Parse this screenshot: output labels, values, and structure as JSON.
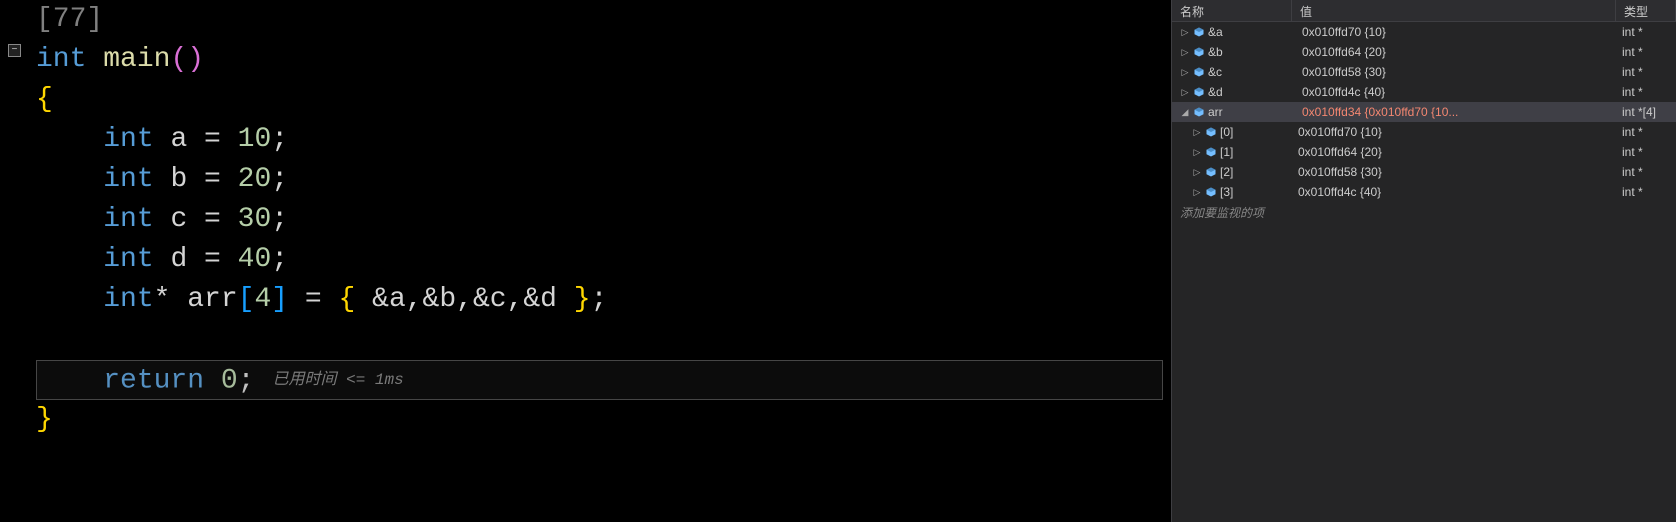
{
  "editor": {
    "fold_symbol": "−",
    "top_line": "[77]",
    "lines": [
      {
        "tokens": [
          {
            "t": "kw",
            "v": "int"
          },
          {
            "t": "sp",
            "v": " "
          },
          {
            "t": "ident",
            "v": "main"
          },
          {
            "t": "paren",
            "v": "()"
          }
        ]
      },
      {
        "tokens": [
          {
            "t": "brace",
            "v": "{"
          }
        ]
      },
      {
        "tokens": [
          {
            "t": "indent",
            "v": "    "
          },
          {
            "t": "kw",
            "v": "int"
          },
          {
            "t": "sp",
            "v": " "
          },
          {
            "t": "op",
            "v": "a = "
          },
          {
            "t": "num",
            "v": "10"
          },
          {
            "t": "punct",
            "v": ";"
          }
        ]
      },
      {
        "tokens": [
          {
            "t": "indent",
            "v": "    "
          },
          {
            "t": "kw",
            "v": "int"
          },
          {
            "t": "sp",
            "v": " "
          },
          {
            "t": "op",
            "v": "b = "
          },
          {
            "t": "num",
            "v": "20"
          },
          {
            "t": "punct",
            "v": ";"
          }
        ]
      },
      {
        "tokens": [
          {
            "t": "indent",
            "v": "    "
          },
          {
            "t": "kw",
            "v": "int"
          },
          {
            "t": "sp",
            "v": " "
          },
          {
            "t": "op",
            "v": "c = "
          },
          {
            "t": "num",
            "v": "30"
          },
          {
            "t": "punct",
            "v": ";"
          }
        ]
      },
      {
        "tokens": [
          {
            "t": "indent",
            "v": "    "
          },
          {
            "t": "kw",
            "v": "int"
          },
          {
            "t": "sp",
            "v": " "
          },
          {
            "t": "op",
            "v": "d = "
          },
          {
            "t": "num",
            "v": "40"
          },
          {
            "t": "punct",
            "v": ";"
          }
        ]
      },
      {
        "tokens": [
          {
            "t": "indent",
            "v": "    "
          },
          {
            "t": "kw",
            "v": "int"
          },
          {
            "t": "op",
            "v": "* "
          },
          {
            "t": "op",
            "v": "arr"
          },
          {
            "t": "bracket",
            "v": "["
          },
          {
            "t": "num",
            "v": "4"
          },
          {
            "t": "bracket",
            "v": "]"
          },
          {
            "t": "op",
            "v": " = "
          },
          {
            "t": "brace",
            "v": "{ "
          },
          {
            "t": "op",
            "v": "&a,&b,&c,&d "
          },
          {
            "t": "brace",
            "v": "}"
          },
          {
            "t": "punct",
            "v": ";"
          }
        ]
      },
      {
        "tokens": []
      },
      {
        "tokens": [
          {
            "t": "indent",
            "v": "    "
          },
          {
            "t": "kw",
            "v": "return"
          },
          {
            "t": "sp",
            "v": " "
          },
          {
            "t": "num",
            "v": "0"
          },
          {
            "t": "punct",
            "v": ";"
          }
        ],
        "timing": true
      },
      {
        "tokens": [
          {
            "t": "brace",
            "v": "}"
          }
        ]
      }
    ],
    "timing_label": "已用时间 <= 1ms"
  },
  "watch": {
    "headers": {
      "name": "名称",
      "value": "值",
      "type": "类型"
    },
    "rows": [
      {
        "depth": 1,
        "expand": "▶",
        "name": "&a",
        "value": "0x010ffd70 {10}",
        "type": "int *"
      },
      {
        "depth": 1,
        "expand": "▶",
        "name": "&b",
        "value": "0x010ffd64 {20}",
        "type": "int *"
      },
      {
        "depth": 1,
        "expand": "▶",
        "name": "&c",
        "value": "0x010ffd58 {30}",
        "type": "int *"
      },
      {
        "depth": 1,
        "expand": "▶",
        "name": "&d",
        "value": "0x010ffd4c {40}",
        "type": "int *"
      },
      {
        "depth": 1,
        "expand": "▲",
        "name": "arr",
        "value": "0x010ffd34 {0x010ffd70 {10...",
        "type": "int *[4]",
        "selected": true,
        "changed": true
      },
      {
        "depth": 2,
        "expand": "▶",
        "name": "[0]",
        "value": "0x010ffd70 {10}",
        "type": "int *"
      },
      {
        "depth": 2,
        "expand": "▶",
        "name": "[1]",
        "value": "0x010ffd64 {20}",
        "type": "int *"
      },
      {
        "depth": 2,
        "expand": "▶",
        "name": "[2]",
        "value": "0x010ffd58 {30}",
        "type": "int *"
      },
      {
        "depth": 2,
        "expand": "▶",
        "name": "[3]",
        "value": "0x010ffd4c {40}",
        "type": "int *"
      }
    ],
    "add_item_label": "添加要监视的项"
  }
}
